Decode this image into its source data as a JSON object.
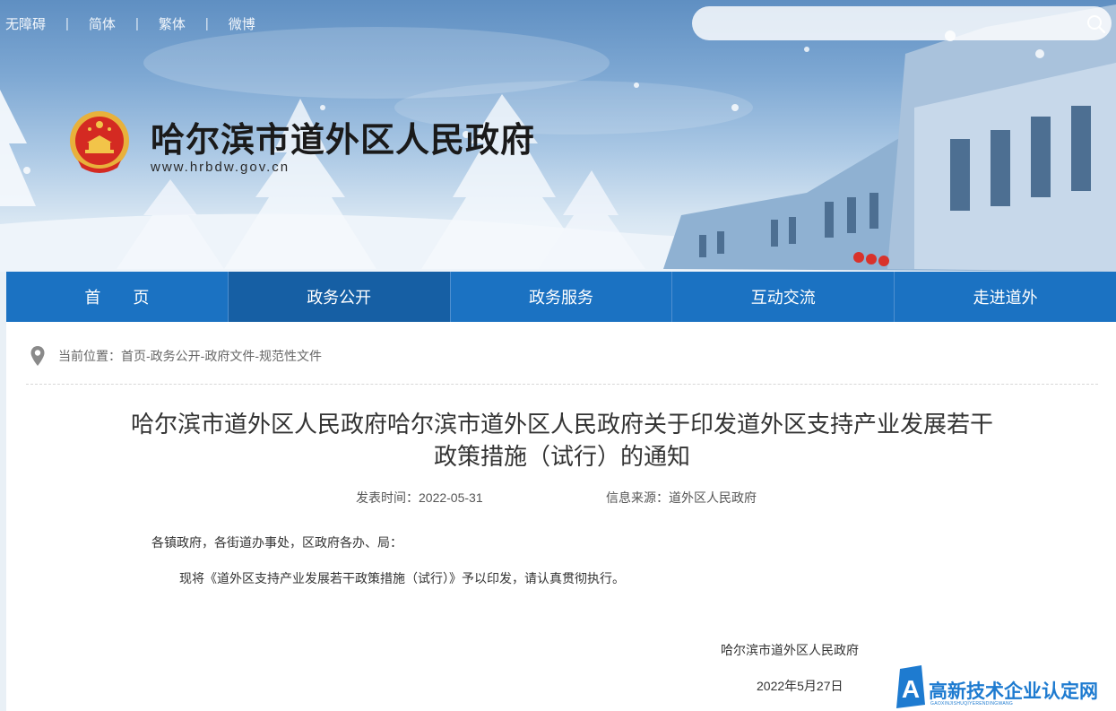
{
  "top_links": [
    "无障碍",
    "简体",
    "繁体",
    "微博"
  ],
  "top_separator": "|",
  "search": {
    "placeholder": ""
  },
  "site": {
    "title": "哈尔滨市道外区人民政府",
    "url": "www.hrbdw.gov.cn"
  },
  "nav": [
    "首　　页",
    "政务公开",
    "政务服务",
    "互动交流",
    "走进道外"
  ],
  "breadcrumb": {
    "prefix": "当前位置：",
    "items": [
      "首页",
      "政务公开",
      "政府文件",
      "规范性文件"
    ],
    "separator": "- "
  },
  "doc": {
    "title_line1": "哈尔滨市道外区人民政府哈尔滨市道外区人民政府关于印发道外区支持产业发展若干",
    "title_line2": "政策措施（试行）的通知",
    "date_label": "发表时间：",
    "date": "2022-05-31",
    "source_label": "信息来源：",
    "source": "道外区人民政府",
    "salutation": "各镇政府，各街道办事处，区政府各办、局：",
    "paragraph": "现将《道外区支持产业发展若干政策措施（试行）》予以印发，请认真贯彻执行。",
    "signer": "哈尔滨市道外区人民政府",
    "sign_date": "2022年5月27日"
  },
  "watermark": {
    "text": "高新技术企业认定网",
    "sub": "GAOXINJISHUQIYERENDINGWANG",
    "letter": "A"
  },
  "colors": {
    "nav": "#1b72c2",
    "nav_active": "#165fa4",
    "watermark": "#1e7bd0"
  }
}
